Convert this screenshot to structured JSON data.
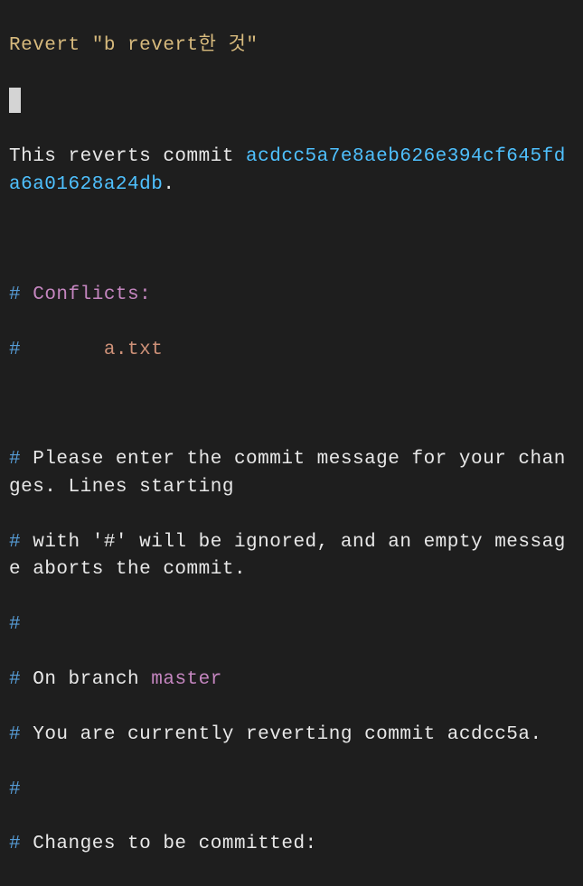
{
  "commit": {
    "subject": "Revert \"b revert한 것\"",
    "reverts_prefix": "This reverts commit ",
    "reverts_hash": "acdcc5a7e8aeb626e394cf645fda6a01628a24db",
    "reverts_suffix": "."
  },
  "conflicts": {
    "hash": "#",
    "header_label": " Conflicts:",
    "file_prefix": "\t",
    "file": "a.txt"
  },
  "instructions": {
    "line1": " Please enter the commit message for your changes. Lines starting",
    "line2": " with '#' will be ignored, and an empty message aborts the commit."
  },
  "status": {
    "on_branch_prefix": " On branch ",
    "branch": "master",
    "reverting": " You are currently reverting commit acdcc5a.",
    "changes_label": " Changes to be committed:"
  }
}
